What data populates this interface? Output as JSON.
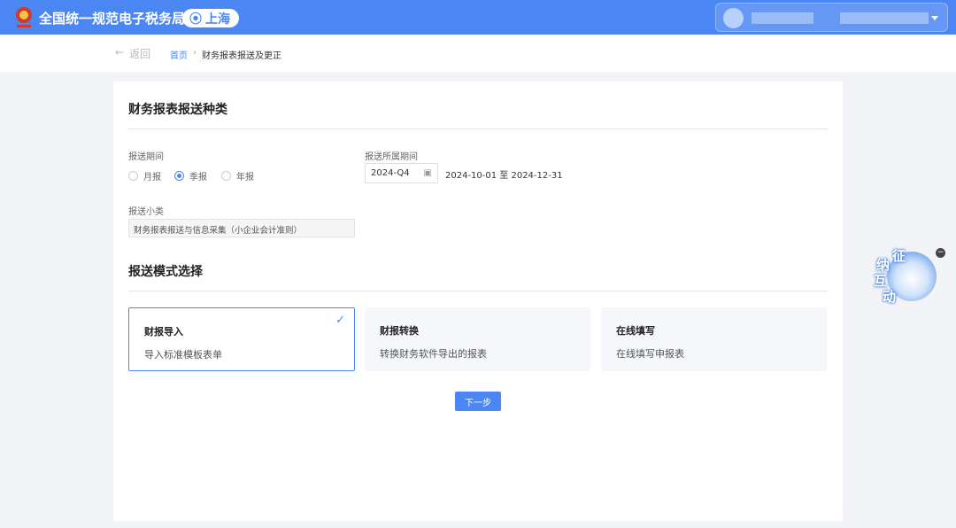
{
  "header": {
    "title": "全国统一规范电子税务局",
    "city": "上海"
  },
  "breadcrumb": {
    "back": "返回",
    "home": "首页",
    "separator": "›",
    "current": "财务报表报送及更正"
  },
  "section1": {
    "title": "财务报表报送种类",
    "period_label": "报送期间",
    "period_options": [
      {
        "label": "月报",
        "selected": false
      },
      {
        "label": "季报",
        "selected": true
      },
      {
        "label": "年报",
        "selected": false
      }
    ],
    "belong_label": "报送所属期间",
    "belong_value": "2024-Q4",
    "range": "2024-10-01 至 2024-12-31",
    "subtype_label": "报送小类",
    "subtype_value": "财务报表报送与信息采集（小企业会计准则）"
  },
  "section2": {
    "title": "报送模式选择",
    "modes": [
      {
        "title": "财报导入",
        "desc": "导入标准模板表单",
        "selected": true
      },
      {
        "title": "财报转换",
        "desc": "转换财务软件导出的报表",
        "selected": false
      },
      {
        "title": "在线填写",
        "desc": "在线填写申报表",
        "selected": false
      }
    ],
    "next": "下一步"
  },
  "float_widget": {
    "chars": [
      "征",
      "纳",
      "互",
      "动"
    ]
  },
  "colors": {
    "primary": "#4b87f2",
    "background": "#f3f4f7"
  }
}
